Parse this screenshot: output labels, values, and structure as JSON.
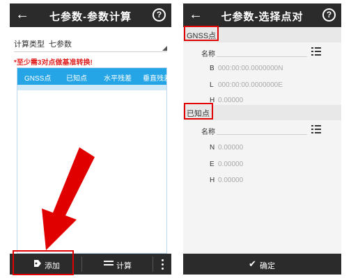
{
  "left_screen": {
    "title": "七参数-参数计算",
    "back_icon": "arrow-left-icon",
    "help_icon": "question-circle-icon",
    "calc_type_label": "计算类型",
    "calc_type_value": "七参数",
    "warning": "*至少需3对点做基准转换!",
    "columns": [
      "GNSS点",
      "已知点",
      "水平残差",
      "垂直残差"
    ],
    "buttons": {
      "add_label": "添加",
      "add_icon": "tag-add-icon",
      "calc_label": "计算",
      "calc_icon": "menu-lines-icon",
      "more_icon": "vertical-dots-icon"
    }
  },
  "right_screen": {
    "title": "七参数-选择点对",
    "back_icon": "arrow-left-icon",
    "help_icon": "question-circle-icon",
    "gnss_section": {
      "header": "GNSS点",
      "name_label": "名称",
      "fields": [
        {
          "label": "B",
          "value": "000:00:00.0000000N"
        },
        {
          "label": "L",
          "value": "000:00:00.0000000E"
        },
        {
          "label": "H",
          "value": "0.00000"
        }
      ]
    },
    "known_section": {
      "header": "已知点",
      "name_label": "名称",
      "fields": [
        {
          "label": "N",
          "value": "0.00000"
        },
        {
          "label": "E",
          "value": "0.00000"
        },
        {
          "label": "H",
          "value": "0.00000"
        }
      ]
    },
    "confirm_label": "确定",
    "confirm_icon": "checkmark-icon",
    "list_icon": "list-select-icon"
  },
  "annotation_colors": {
    "highlight": "#e00000",
    "table_header": "#26a5e6",
    "toolbar": "#2b2b2b"
  }
}
